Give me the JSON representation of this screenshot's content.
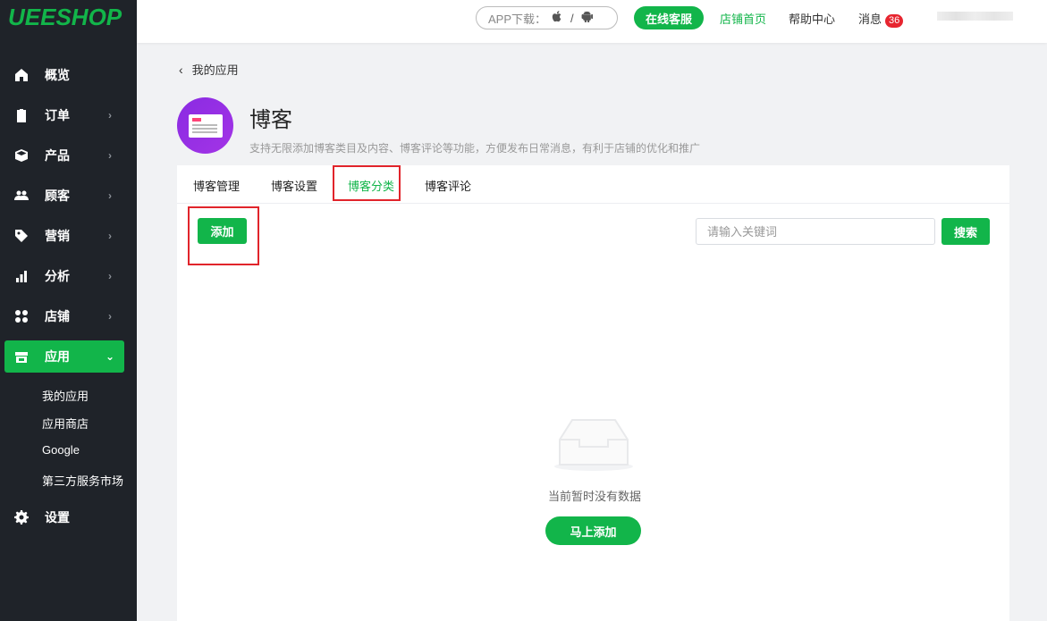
{
  "logo": "UEESHOP",
  "topbar": {
    "app_download": "APP下载：",
    "online_service": "在线客服",
    "store_home": "店铺首页",
    "help_center": "帮助中心",
    "messages": "消息",
    "message_count": "36"
  },
  "sidebar": {
    "items": [
      {
        "label": "概览",
        "icon": "home-icon"
      },
      {
        "label": "订单",
        "icon": "order-icon"
      },
      {
        "label": "产品",
        "icon": "box-icon"
      },
      {
        "label": "顾客",
        "icon": "users-icon"
      },
      {
        "label": "营销",
        "icon": "tag-icon"
      },
      {
        "label": "分析",
        "icon": "bar-chart-icon"
      },
      {
        "label": "店铺",
        "icon": "grid-icon"
      },
      {
        "label": "应用",
        "icon": "store-icon"
      },
      {
        "label": "设置",
        "icon": "gear-icon"
      }
    ],
    "sub_items": [
      "我的应用",
      "应用商店",
      "Google",
      "第三方服务市场"
    ]
  },
  "breadcrumb": "我的应用",
  "app": {
    "title": "博客",
    "description": "支持无限添加博客类目及内容、博客评论等功能，方便发布日常消息，有利于店铺的优化和推广"
  },
  "tabs": [
    "博客管理",
    "博客设置",
    "博客分类",
    "博客评论"
  ],
  "active_tab": "博客分类",
  "toolbar": {
    "add_label": "添加",
    "search_placeholder": "请输入关键词",
    "search_label": "搜索"
  },
  "empty": {
    "text": "当前暂时没有数据",
    "button": "马上添加"
  },
  "colors": {
    "accent": "#12b54a",
    "sidebar_bg": "#1f2329",
    "highlight_border": "#e1242b",
    "badge": "#e7252f"
  }
}
